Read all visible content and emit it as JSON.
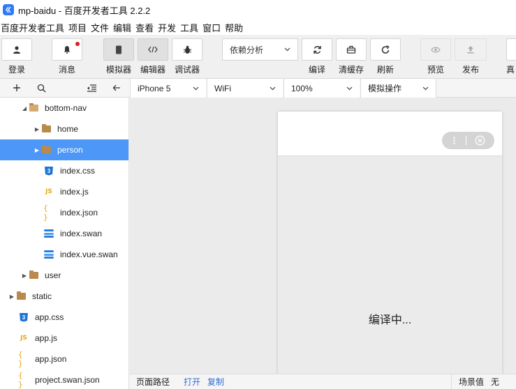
{
  "window": {
    "title": "mp-baidu - 百度开发者工具 2.2.2"
  },
  "menu": [
    "百度开发者工具",
    "项目",
    "文件",
    "编辑",
    "查看",
    "开发",
    "工具",
    "窗口",
    "帮助"
  ],
  "toolbar": {
    "login": "登录",
    "messages": "消息",
    "simulator": "模拟器",
    "editor": "编辑器",
    "debugger": "调试器",
    "dependency": "依赖分析",
    "compile": "编译",
    "clear_cache": "清缓存",
    "refresh": "刷新",
    "preview": "预览",
    "publish": "发布",
    "real_device": "真"
  },
  "subbar": {
    "device": "iPhone 5",
    "network": "WiFi",
    "zoom": "100%",
    "simulate": "模拟操作"
  },
  "tree": [
    {
      "label": "bottom-nav",
      "type": "folder-open",
      "depth": 2,
      "arrow": "down"
    },
    {
      "label": "home",
      "type": "folder",
      "depth": 3,
      "arrow": "right"
    },
    {
      "label": "person",
      "type": "folder",
      "depth": 3,
      "arrow": "right",
      "selected": true
    },
    {
      "label": "index.css",
      "type": "css",
      "depth": 3
    },
    {
      "label": "index.js",
      "type": "js",
      "depth": 3
    },
    {
      "label": "index.json",
      "type": "json",
      "depth": 3
    },
    {
      "label": "index.swan",
      "type": "swan",
      "depth": 3
    },
    {
      "label": "index.vue.swan",
      "type": "swan",
      "depth": 3
    },
    {
      "label": "user",
      "type": "folder",
      "depth": 2,
      "arrow": "right"
    },
    {
      "label": "static",
      "type": "folder",
      "depth": 1,
      "arrow": "right"
    },
    {
      "label": "app.css",
      "type": "css",
      "depth": 1
    },
    {
      "label": "app.js",
      "type": "js",
      "depth": 1
    },
    {
      "label": "app.json",
      "type": "json",
      "depth": 1
    },
    {
      "label": "project.swan.json",
      "type": "json",
      "depth": 1
    }
  ],
  "icons": {
    "css": "3",
    "js": "JS",
    "json": "{ }"
  },
  "simulator": {
    "loading_text": "编译中..."
  },
  "status": {
    "page_path": "页面路径",
    "open": "打开",
    "copy": "复制",
    "scene_label": "场景值",
    "scene_value": "无"
  },
  "colors": {
    "selected": "#4c97f7",
    "notify_dot": "#e31b1b",
    "link": "#2f6fd8"
  }
}
